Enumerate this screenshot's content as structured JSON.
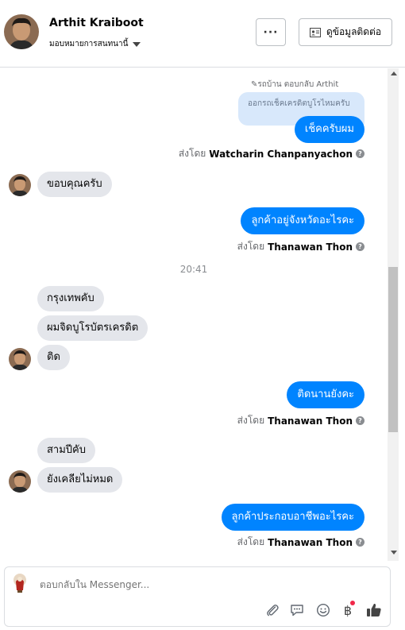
{
  "header": {
    "name": "Arthit Kraiboot",
    "assign_label": "มอบหมายการสนทนานี้",
    "more_label": "···",
    "contact_button": "ดูข้อมูลติดต่อ"
  },
  "messages": {
    "reply_ref": "รถบ้าน ตอบกลับ Arthit",
    "quoted_text": "ออกรถเช็คเครดิตบูโรไหมครับ",
    "out1": "เช็คครับผม",
    "sentby_prefix": "ส่งโดย",
    "out1_sender": "Watcharin Chanpanyachon",
    "in1": "ขอบคุณครับ",
    "out2": "ลูกค้าอยู่จังหวัดอะไรคะ",
    "out2_sender": "Thanawan Thon",
    "time": "20:41",
    "in2": "กรุงเทพคับ",
    "in3": "ผมจิดบูโรบัตรเครดิต",
    "in4": "ติด",
    "out3": "ติดนานยังคะ",
    "out3_sender": "Thanawan Thon",
    "in5": "สามปีคับ",
    "in6": "ยังเคลียไม่หมด",
    "out4": "ลูกค้าประกอบอาชีพอะไรคะ",
    "out4_sender": "Thanawan Thon"
  },
  "composer": {
    "placeholder": "ตอบกลับใน Messenger..."
  },
  "colors": {
    "accent": "#0084ff",
    "incoming": "#e4e6eb",
    "notification_dot": "#f02849"
  }
}
